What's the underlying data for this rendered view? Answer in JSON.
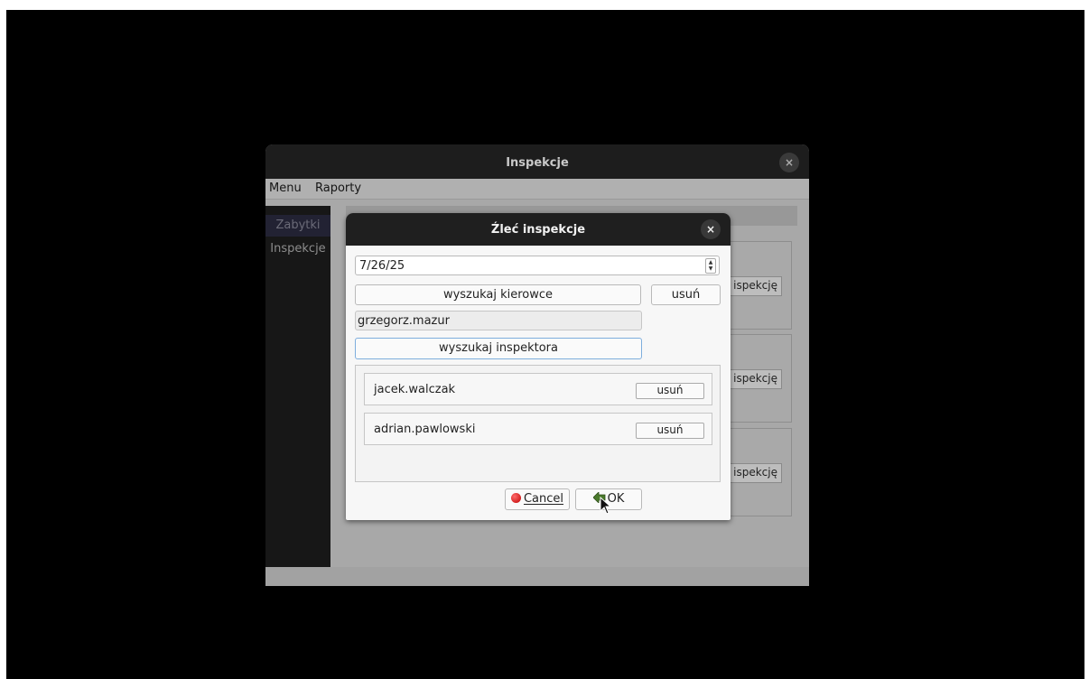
{
  "main_window": {
    "title": "Inspekcje",
    "close_glyph": "×",
    "menu": [
      "Menu",
      "Raporty"
    ],
    "sidebar": [
      "Zabytki",
      "Inspekcje"
    ],
    "card_button_label": "ispekcję"
  },
  "dialog": {
    "title": "Źleć inspekcje",
    "close_glyph": "×",
    "date_value": "7/26/25",
    "search_driver_label": "wyszukaj kierowce",
    "remove_driver_label": "usuń",
    "inspector_value": "grzegorz.mazur",
    "search_inspector_label": "wyszukaj inspektora",
    "inspectors": [
      {
        "name": "jacek.walczak",
        "remove_label": "usuń"
      },
      {
        "name": "adrian.pawlowski",
        "remove_label": "usuń"
      }
    ],
    "cancel_label": "Cancel",
    "ok_label": "OK"
  },
  "colors": {
    "titlebar": "#1d1d1d",
    "dim_overlay": "#a8a8a8",
    "focus_border": "#7eaedd"
  },
  "icons": {
    "cancel": "red-circle-icon",
    "ok": "ok-arrow-icon",
    "close": "close-icon"
  }
}
